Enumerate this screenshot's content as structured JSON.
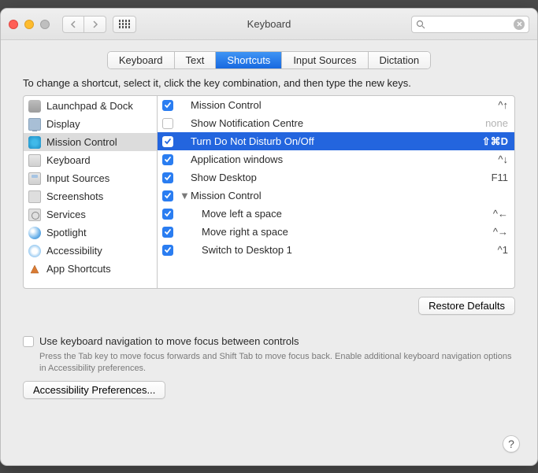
{
  "title": "Keyboard",
  "search_placeholder": "",
  "tabs": [
    "Keyboard",
    "Text",
    "Shortcuts",
    "Input Sources",
    "Dictation"
  ],
  "active_tab_index": 2,
  "instruction": "To change a shortcut, select it, click the key combination, and then type the new keys.",
  "categories": [
    {
      "label": "Launchpad & Dock",
      "icon": "launchpad"
    },
    {
      "label": "Display",
      "icon": "display"
    },
    {
      "label": "Mission Control",
      "icon": "mission",
      "selected": true
    },
    {
      "label": "Keyboard",
      "icon": "keyboard"
    },
    {
      "label": "Input Sources",
      "icon": "input"
    },
    {
      "label": "Screenshots",
      "icon": "screenshots"
    },
    {
      "label": "Services",
      "icon": "services"
    },
    {
      "label": "Spotlight",
      "icon": "spotlight"
    },
    {
      "label": "Accessibility",
      "icon": "access"
    },
    {
      "label": "App Shortcuts",
      "icon": "app"
    }
  ],
  "shortcuts": [
    {
      "checked": true,
      "name": "Mission Control",
      "key": "^↑",
      "indent": 0
    },
    {
      "checked": false,
      "name": "Show Notification Centre",
      "key": "none",
      "indent": 0
    },
    {
      "checked": true,
      "name": "Turn Do Not Disturb On/Off",
      "key": "⇧⌘D",
      "indent": 0,
      "selected": true
    },
    {
      "checked": true,
      "name": "Application windows",
      "key": "^↓",
      "indent": 0
    },
    {
      "checked": true,
      "name": "Show Desktop",
      "key": "F11",
      "indent": 0
    },
    {
      "checked": true,
      "name": "Mission Control",
      "key": "",
      "indent": 0,
      "expandable": true
    },
    {
      "checked": true,
      "name": "Move left a space",
      "key": "^←",
      "indent": 1
    },
    {
      "checked": true,
      "name": "Move right a space",
      "key": "^→",
      "indent": 1
    },
    {
      "checked": true,
      "name": "Switch to Desktop 1",
      "key": "^1",
      "indent": 1
    }
  ],
  "restore_label": "Restore Defaults",
  "keynav_label": "Use keyboard navigation to move focus between controls",
  "keynav_sub": "Press the Tab key to move focus forwards and Shift Tab to move focus back. Enable additional keyboard navigation options in Accessibility preferences.",
  "access_pref_label": "Accessibility Preferences...",
  "help_label": "?"
}
